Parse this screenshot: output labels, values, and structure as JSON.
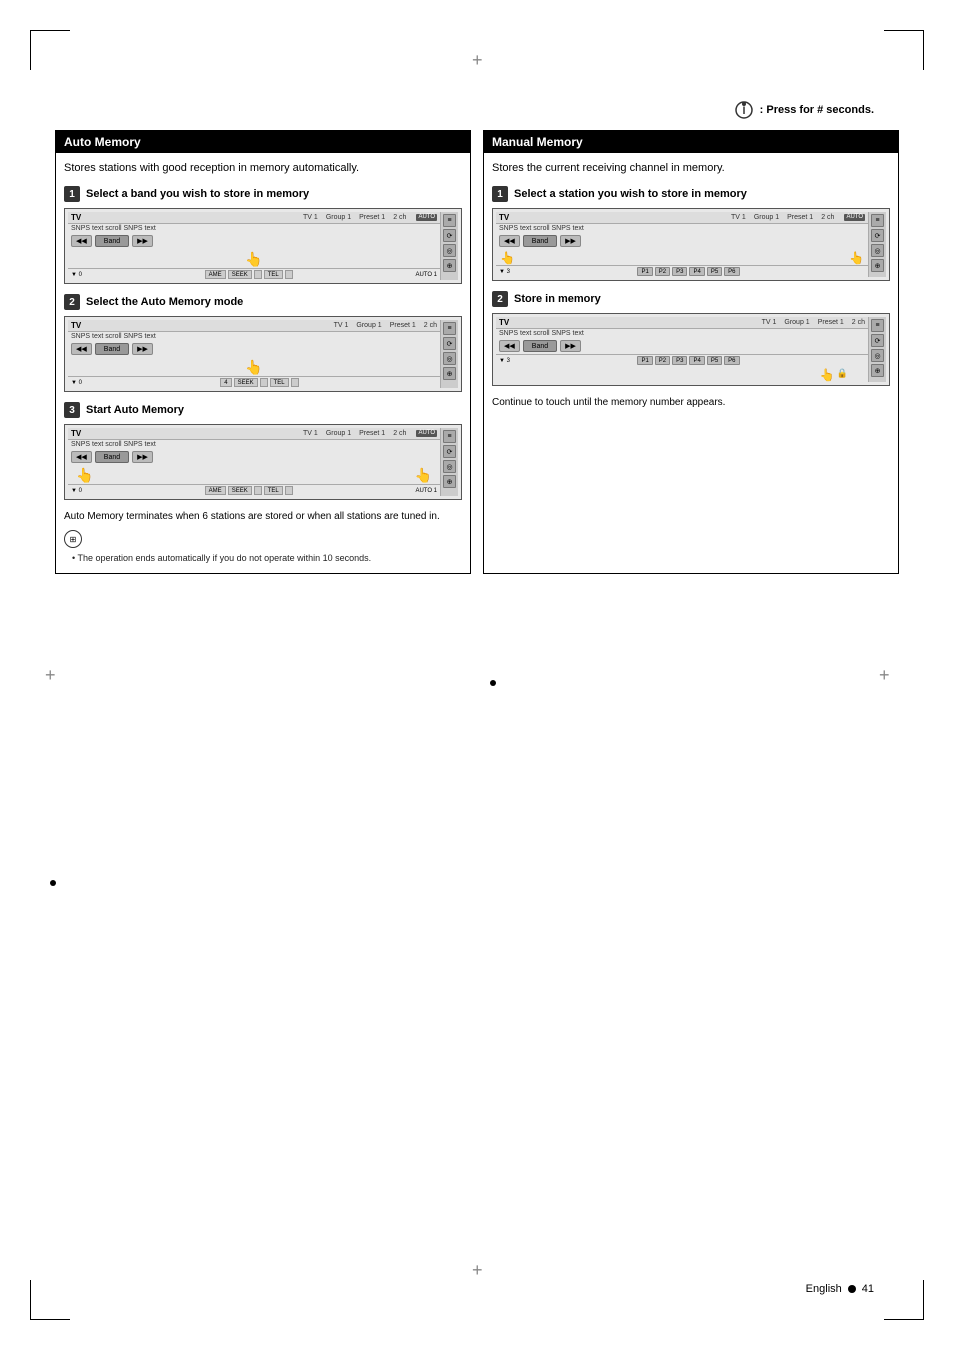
{
  "page": {
    "number": "41",
    "language": "English"
  },
  "press_instruction": {
    "text": ": Press for # seconds."
  },
  "auto_memory": {
    "title": "Auto Memory",
    "description": "Stores stations with good reception in memory automatically.",
    "steps": [
      {
        "num": "1",
        "label": "Select a band you wish to store in memory",
        "tv": {
          "label": "TV",
          "info1": "TV 1",
          "info2": "Group 1",
          "info3": "Preset 1",
          "info4": "2 ch",
          "scroll": "SNPS text scroll SNPS text",
          "band": "Band",
          "auto_tag": "AUTO"
        },
        "touch": true
      },
      {
        "num": "2",
        "label": "Select the Auto Memory mode",
        "tv": {
          "label": "TV",
          "info1": "TV 1",
          "info2": "Group 1",
          "info3": "Preset 1",
          "info4": "2 ch",
          "scroll": "SNPS text scroll SNPS text",
          "band": "Band"
        },
        "touch": true
      },
      {
        "num": "3",
        "label": "Start Auto Memory",
        "tv": {
          "label": "TV",
          "info1": "TV 1",
          "info2": "Group 1",
          "info3": "Preset 1",
          "info4": "2 ch",
          "scroll": "SNPS text scroll SNPS text",
          "band": "Band",
          "auto_tag": "AUTO 1"
        },
        "touch": true
      }
    ],
    "note_text": "Auto Memory terminates when 6 stations are stored or when all stations are tuned in.",
    "bullet_note": "The operation ends automatically if you do not operate within 10 seconds."
  },
  "manual_memory": {
    "title": "Manual Memory",
    "description": "Stores the current receiving channel in memory.",
    "steps": [
      {
        "num": "1",
        "label": "Select a station you wish to store in memory",
        "tv": {
          "label": "TV",
          "info1": "TV 1",
          "info2": "Group 1",
          "info3": "Preset 1",
          "info4": "2 ch",
          "scroll": "SNPS text scroll SNPS text",
          "band": "Band"
        },
        "touch": true,
        "show_presets": false
      },
      {
        "num": "2",
        "label": "Store in memory",
        "tv": {
          "label": "TV",
          "info1": "TV 1",
          "info2": "Group 1",
          "info3": "Preset 1",
          "info4": "2 ch",
          "scroll": "SNPS text scroll SNPS text",
          "band": "Band"
        },
        "touch": true,
        "show_presets": true,
        "presets": [
          "P1",
          "P2",
          "P3",
          "P4",
          "P5",
          "P6"
        ]
      }
    ],
    "note_text": "Continue to touch until the memory number appears."
  },
  "bottom_note_label": "Continue to touch until the memory number appears."
}
